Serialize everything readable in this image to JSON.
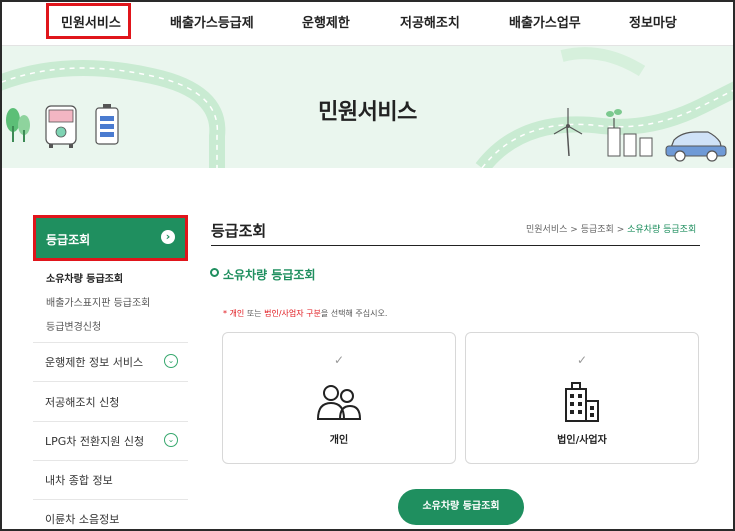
{
  "nav": {
    "items": [
      "민원서비스",
      "배출가스등급제",
      "운행제한",
      "저공해조치",
      "배출가스업무",
      "정보마당"
    ]
  },
  "banner": {
    "title": "민원서비스"
  },
  "sidebar": {
    "active": "등급조회",
    "sub_items": [
      "소유차량 등급조회",
      "배출가스표지판 등급조회",
      "등급변경신청"
    ],
    "rows": [
      "운행제한 정보 서비스",
      "저공해조치 신청",
      "LPG차 전환지원 신청",
      "내차 종합 정보",
      "이륜차 소음정보"
    ]
  },
  "main": {
    "title": "등급조회",
    "breadcrumb": [
      "민원서비스",
      ">",
      "등급조회",
      ">",
      "소유차량 등급조회"
    ],
    "section": "소유차량 등급조회",
    "notice": {
      "star": "*",
      "opt1": "개인",
      "mid": " 또는 ",
      "opt2": "법인/사업자 구분",
      "tail": "을 선택해 주십시오."
    },
    "cards": [
      {
        "label": "개인",
        "icon": "people-icon"
      },
      {
        "label": "법인/사업자",
        "icon": "building-icon"
      }
    ],
    "button": "소유차량 등급조회"
  },
  "colors": {
    "accent": "#1f8f5f",
    "highlight": "#e0151b",
    "banner_bg": "#eaf6ee"
  }
}
